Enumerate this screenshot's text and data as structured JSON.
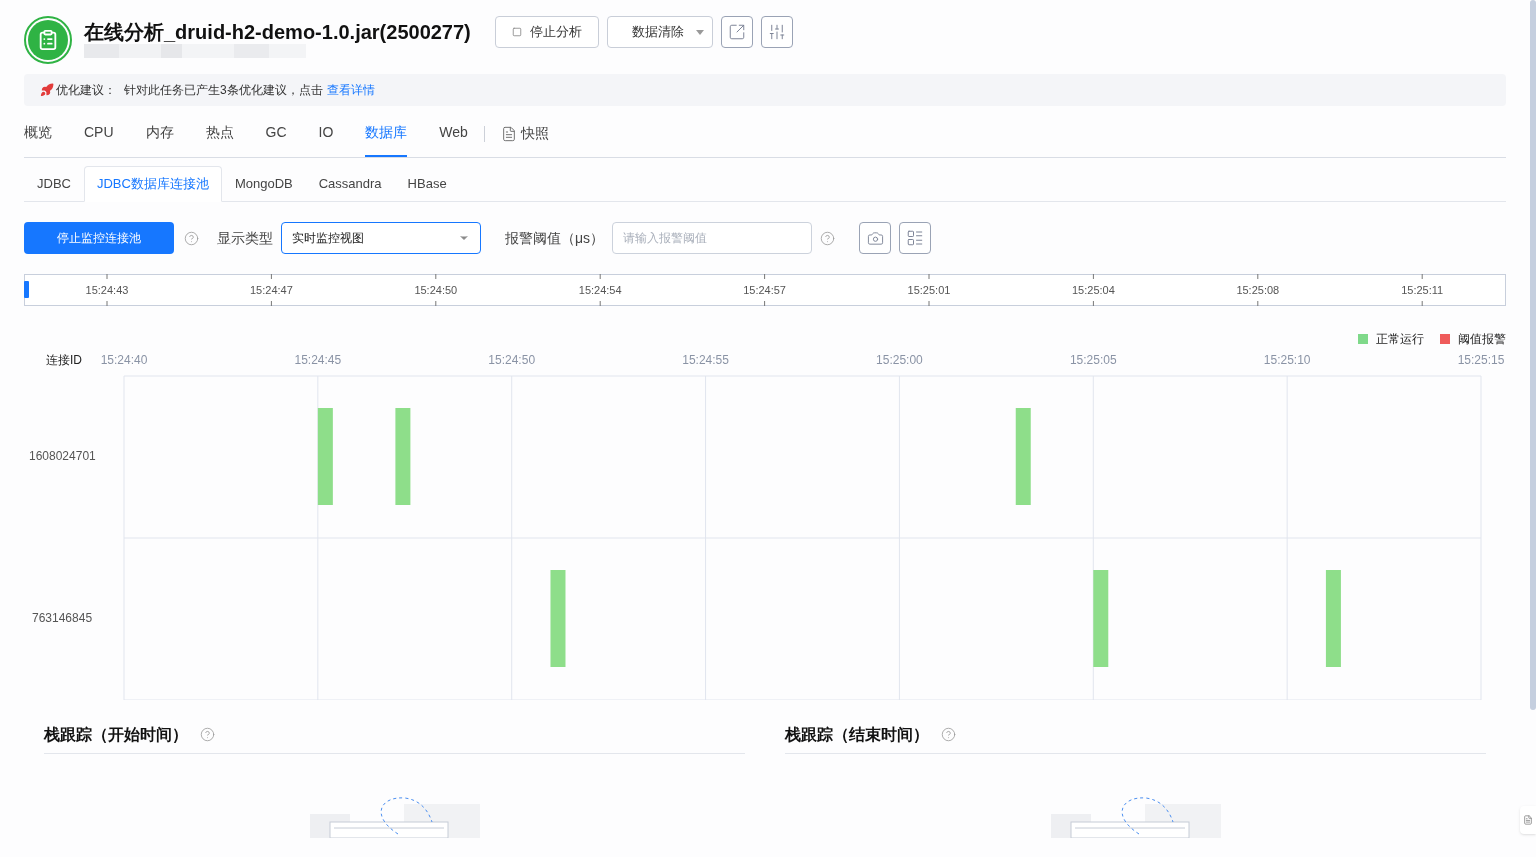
{
  "header": {
    "title": "在线分析_druid-h2-demo-1.0.jar(2500277)",
    "buttons": [
      {
        "kind": "stop",
        "label": "停止分析"
      },
      {
        "kind": "dropdown",
        "label": "数据清除"
      },
      {
        "kind": "icon-share"
      },
      {
        "kind": "icon-settings"
      }
    ]
  },
  "banner": {
    "label": "优化建议：",
    "text": "针对此任务已产生3条优化建议，点击",
    "link": "查看详情"
  },
  "tabs": [
    {
      "label": "概览",
      "selected": false
    },
    {
      "label": "CPU",
      "selected": false
    },
    {
      "label": "内存",
      "selected": false
    },
    {
      "label": "热点",
      "selected": false
    },
    {
      "label": "GC",
      "selected": false
    },
    {
      "label": "IO",
      "selected": false
    },
    {
      "label": "数据库",
      "selected": true
    },
    {
      "label": "Web",
      "selected": false
    }
  ],
  "snapshot_tab": {
    "label": "快照"
  },
  "sub_tabs": [
    {
      "label": "JDBC",
      "selected": false
    },
    {
      "label": "JDBC数据库连接池",
      "selected": true
    },
    {
      "label": "MongoDB",
      "selected": false
    },
    {
      "label": "Cassandra",
      "selected": false
    },
    {
      "label": "HBase",
      "selected": false
    }
  ],
  "toolbar": {
    "primary_button": "停止监控连接池",
    "display_type_label": "显示类型",
    "display_type_value": "实时监控视图",
    "threshold_label": "报警阈值（μs）",
    "threshold_placeholder": "请输入报警阈值"
  },
  "time_range": {
    "level": 0,
    "ticks": [
      "15:24:43",
      "15:24:47",
      "15:24:50",
      "15:24:54",
      "15:24:57",
      "15:25:01",
      "15:25:04",
      "15:25:08",
      "15:25:11"
    ]
  },
  "legend": [
    {
      "label": "正常运行",
      "color": "#7fd98a"
    },
    {
      "label": "阈值报警",
      "color": "#ef5b5b"
    }
  ],
  "connection_timeline": {
    "id_header": "连接ID",
    "time_labels": [
      "15:24:40",
      "15:24:45",
      "15:24:50",
      "15:24:55",
      "15:25:00",
      "15:25:05",
      "15:25:10",
      "15:25:15"
    ],
    "rows": [
      {
        "id": "1608024701"
      },
      {
        "id": "763146845"
      }
    ]
  },
  "sections": [
    {
      "title": "栈跟踪（开始时间）"
    },
    {
      "title": "栈跟踪（结束时间）"
    }
  ]
}
